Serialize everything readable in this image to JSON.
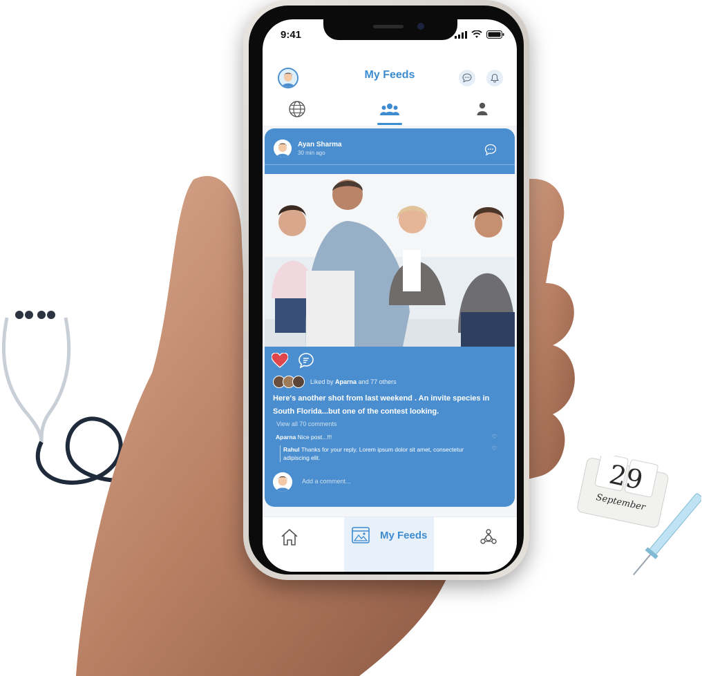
{
  "status_bar": {
    "time": "9:41"
  },
  "header": {
    "title": "My Feeds"
  },
  "tabs": [
    {
      "name": "globe",
      "icon": "globe-icon"
    },
    {
      "name": "groups",
      "icon": "group-icon",
      "active": true
    },
    {
      "name": "profile",
      "icon": "person-icon"
    }
  ],
  "post": {
    "author": "Ayan Sharma",
    "time": "30 min ago",
    "liked_by_prefix": "Liked by",
    "liked_by_name": "Aparna",
    "liked_by_suffix": "and 77 others",
    "caption": "Here's another shot from last weekend . An invite species in South Florida...but one of the contest looking.",
    "view_all": "View all 70 comments",
    "comments": [
      {
        "author": "Aparna",
        "text": "Nice post...!!!"
      },
      {
        "author": "Rahul",
        "text": "Thanks for your reply. Lorem ipsum dolor sit amet, consectetur adipiscing elit."
      }
    ],
    "add_comment_placeholder": "Add a comment..."
  },
  "bottom_nav": {
    "feeds_label": "My Feeds"
  },
  "calendar": {
    "day": "29",
    "month": "September"
  },
  "colors": {
    "accent": "#3d8bd0",
    "card": "#4a8ecf",
    "like": "#e0474c"
  }
}
